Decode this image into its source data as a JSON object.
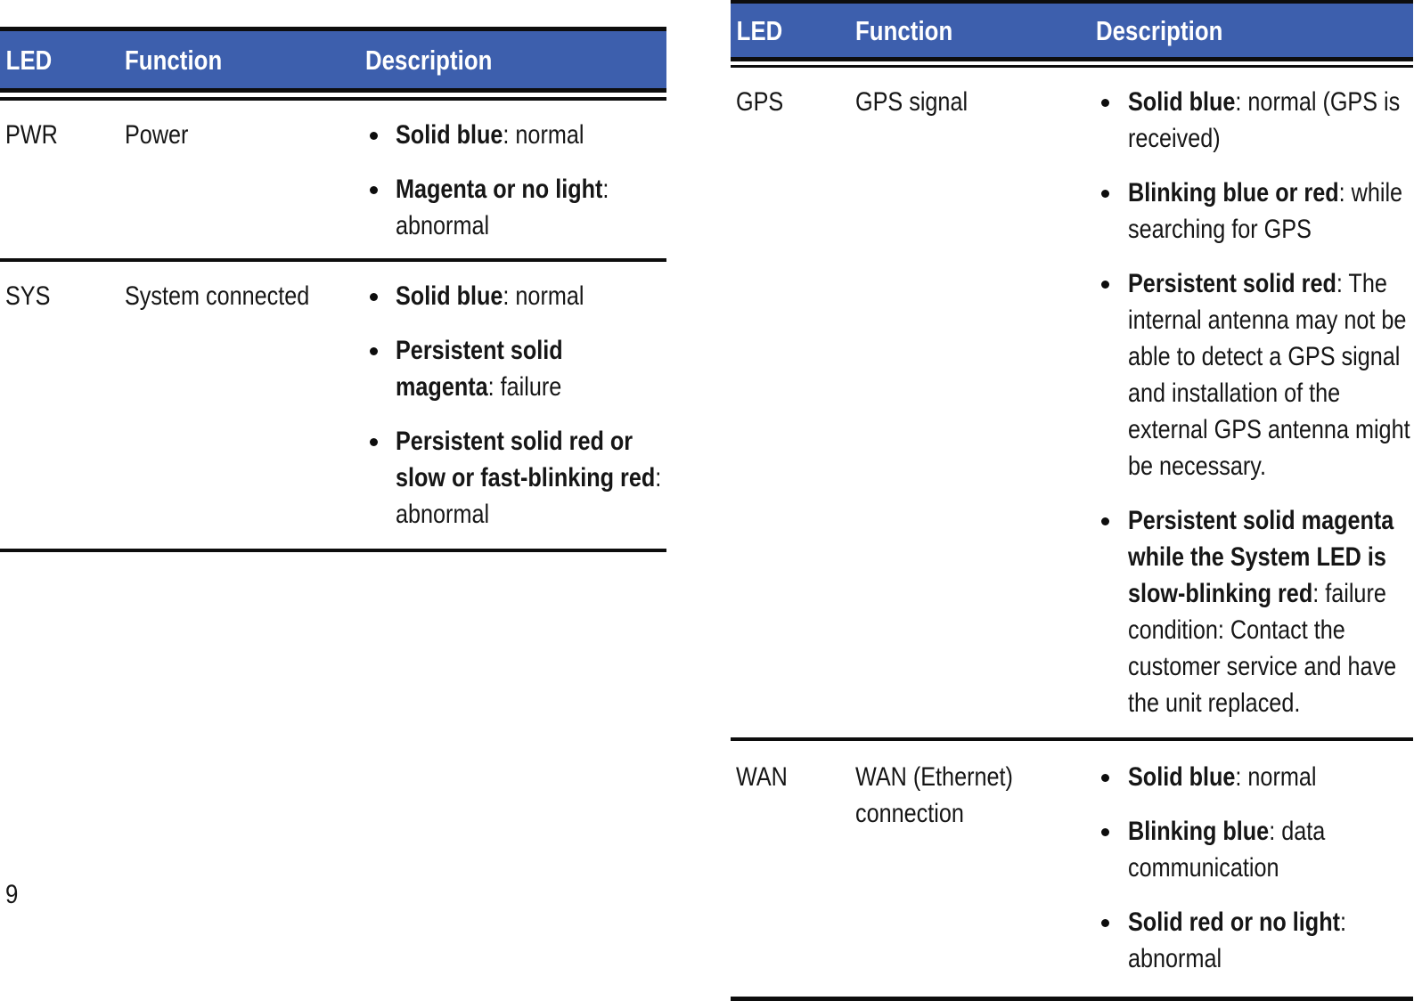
{
  "document": {
    "page_number": "9"
  },
  "tables": [
    {
      "id": "led-table-left",
      "header": {
        "led": "LED",
        "function": "Function",
        "description": "Description"
      },
      "rows": [
        {
          "led": "PWR",
          "function": "Power",
          "bullets": [
            {
              "strong": "Solid blue",
              "rest": ": normal"
            },
            {
              "strong": "Magenta or no light",
              "rest": ": abnormal"
            }
          ]
        },
        {
          "led": "SYS",
          "function": "System connected",
          "bullets": [
            {
              "strong": "Solid blue",
              "rest": ": normal"
            },
            {
              "strong": "Persistent solid magenta",
              "rest": ": failure"
            },
            {
              "strong": "Persistent solid red or slow or fast-blinking red",
              "rest": ": abnormal"
            }
          ]
        }
      ]
    },
    {
      "id": "led-table-right",
      "header": {
        "led": "LED",
        "function": "Function",
        "description": "Description"
      },
      "rows": [
        {
          "led": "GPS",
          "function": "GPS signal",
          "bullets": [
            {
              "strong": "Solid blue",
              "rest": ": normal (GPS is received)"
            },
            {
              "strong": "Blinking blue or red",
              "rest": ": while searching for GPS"
            },
            {
              "strong": "Persistent solid red",
              "rest": ": The internal antenna may not be able to detect a GPS signal and installation of the external GPS antenna might be necessary."
            },
            {
              "strong": "Persistent solid magenta while the System LED is slow-blinking red",
              "rest": ": failure condition: Contact the customer service and have the unit replaced."
            }
          ]
        },
        {
          "led": "WAN",
          "function": "WAN (Ethernet) connection",
          "bullets": [
            {
              "strong": "Solid blue",
              "rest": ": normal"
            },
            {
              "strong": "Blinking blue",
              "rest": ": data communication"
            },
            {
              "strong": "Solid red or no light",
              "rest": ": abnormal"
            }
          ]
        }
      ]
    }
  ],
  "colors": {
    "header_background": "#3d5fad",
    "header_text": "#ffffff",
    "rule": "#0d0d0d",
    "body_text": "#161616",
    "page_background": "#ffffff"
  }
}
